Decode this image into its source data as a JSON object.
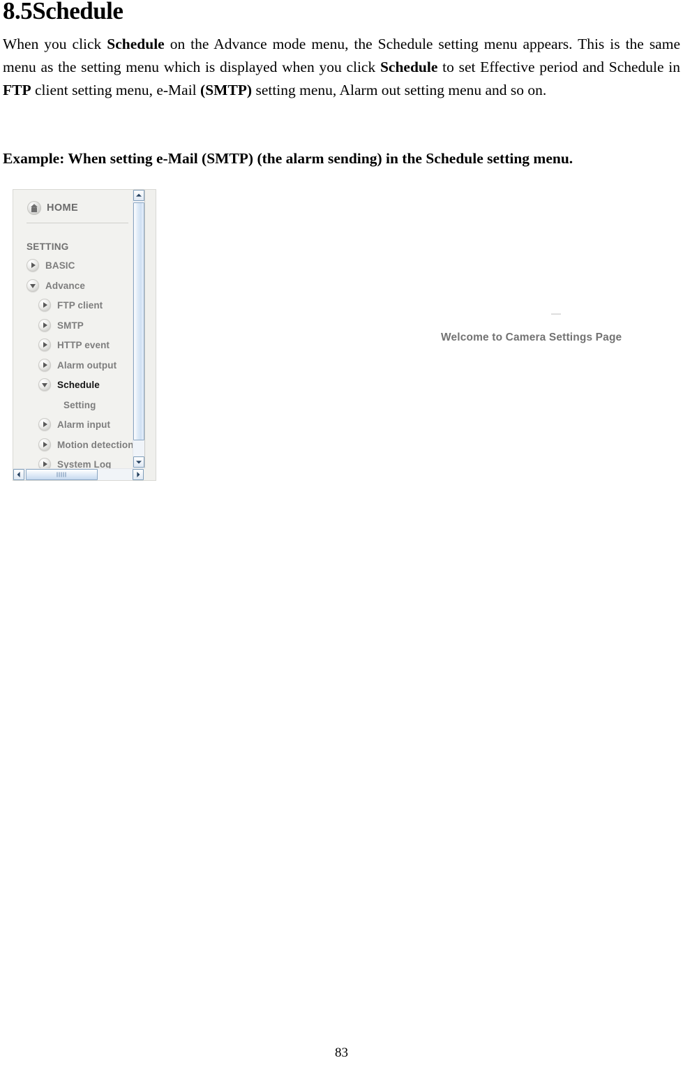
{
  "document": {
    "heading": "8.5Schedule",
    "paragraph_html": "When you click <b>Schedule</b> on the Advance mode menu, the Schedule setting menu appears. This is the same menu as the setting menu which is displayed when you click <b>Schedule</b> to set Effective period and Schedule in <b>FTP</b> client setting menu, e-Mail <b>(SMTP)</b> setting menu, Alarm out setting menu and so on.",
    "example_line": "Example: When setting e-Mail (SMTP) (the alarm sending) in the Schedule setting menu.",
    "page_number": "83"
  },
  "screenshot": {
    "home": {
      "label": "HOME",
      "icon": "home-icon"
    },
    "section_title": "SETTING",
    "menu": [
      {
        "label": "BASIC",
        "level": 1,
        "bullet": "right",
        "selected": false
      },
      {
        "label": "Advance",
        "level": 1,
        "bullet": "down",
        "selected": false
      },
      {
        "label": "FTP client",
        "level": 2,
        "bullet": "right",
        "selected": false
      },
      {
        "label": "SMTP",
        "level": 2,
        "bullet": "right",
        "selected": false
      },
      {
        "label": "HTTP event",
        "level": 2,
        "bullet": "right",
        "selected": false
      },
      {
        "label": "Alarm output",
        "level": 2,
        "bullet": "right",
        "selected": false
      },
      {
        "label": "Schedule",
        "level": 2,
        "bullet": "down",
        "selected": true
      },
      {
        "label": "Setting",
        "level": 3,
        "bullet": "none",
        "selected": false
      },
      {
        "label": "Alarm input",
        "level": 2,
        "bullet": "right",
        "selected": false
      },
      {
        "label": "Motion detection",
        "level": 2,
        "bullet": "right",
        "selected": false
      },
      {
        "label": "System Log",
        "level": 2,
        "bullet": "right",
        "selected": false
      }
    ],
    "content": {
      "welcome_text": "Welcome to Camera Settings Page"
    },
    "scrollbars": {
      "vertical": {
        "up_icon": "chevron-up-icon",
        "down_icon": "chevron-down-icon"
      },
      "horizontal": {
        "left_icon": "chevron-left-icon",
        "right_icon": "chevron-right-icon"
      }
    },
    "colors": {
      "panel_bg": "#f2f2ef",
      "menu_text": "#7d7d7d",
      "selected_text": "#141414",
      "scrollbar_accent": "#7f9db9",
      "welcome_text": "#737373"
    }
  }
}
